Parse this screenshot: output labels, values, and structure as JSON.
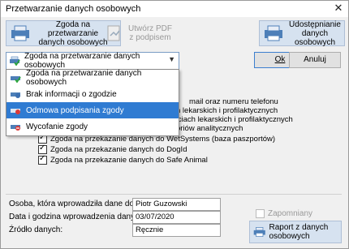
{
  "window": {
    "title": "Przetwarzanie danych osobowych"
  },
  "toolbar": {
    "consent_button": "Zgoda na przetwarzanie danych osobowych",
    "pdf_button": "Utwórz PDF z podpisem",
    "share_button": "Udostępnianie danych osobowych"
  },
  "combo": {
    "selected": "Zgoda na przetwarzanie danych osobowych"
  },
  "dropdown": {
    "options": [
      {
        "label": "Zgoda na przetwarzanie danych osobowych"
      },
      {
        "label": "Brak informacji o zgodzie"
      },
      {
        "label": "Odmowa podpisania zgody"
      },
      {
        "label": "Wycofanie zgody"
      }
    ]
  },
  "actions": {
    "ok": "Ok",
    "cancel": "Anuluj"
  },
  "checkboxes": [
    {
      "label": "mail oraz numeru telefonu",
      "checked": true
    },
    {
      "label": "h lekarskich i profilaktycznych",
      "checked": true
    },
    {
      "label": "ściach lekarskich i profilaktycznych",
      "checked": true
    },
    {
      "label": "oriów analitycznych",
      "checked": true
    },
    {
      "label": "Zgoda na przekazanie danych do WetSystems (baza paszportów)",
      "checked": true
    },
    {
      "label": "Zgoda na przekazanie danych do DogId",
      "checked": true
    },
    {
      "label": "Zgoda na przekazanie danych do Safe Animal",
      "checked": true
    }
  ],
  "footer": {
    "entered_by_label": "Osoba, która wprowadziła dane do systemu:",
    "entered_by_value": "Piotr Guzowski",
    "date_label": "Data i godzina wprowadzenia danych:",
    "date_value": "03/07/2020",
    "source_label": "Źródło danych:",
    "source_value": "Ręcznie",
    "forgotten_label": "Zapomniany",
    "report_button": "Raport z danych osobowych"
  }
}
